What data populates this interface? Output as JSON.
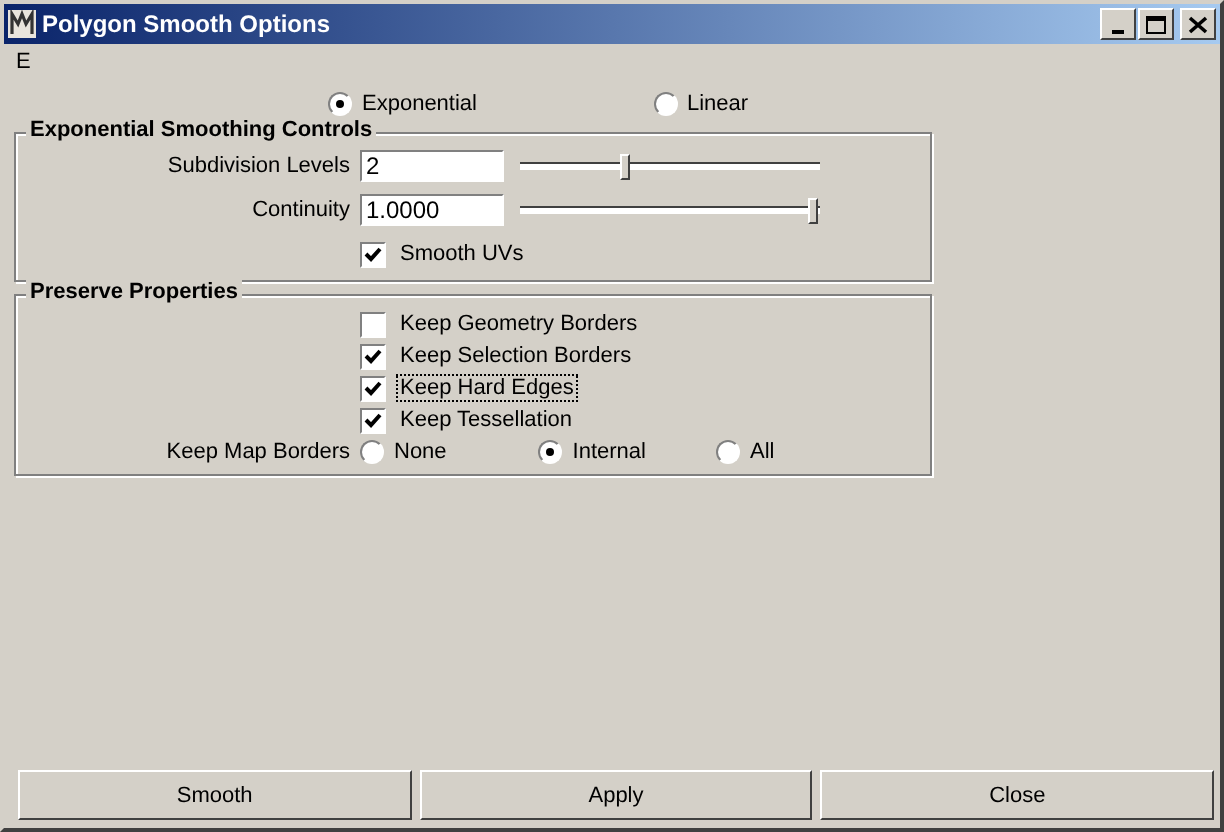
{
  "window": {
    "title": "Polygon Smooth Options"
  },
  "menu": [
    {
      "label": "E"
    }
  ],
  "method": {
    "options": [
      {
        "label": "Exponential",
        "selected": true
      },
      {
        "label": "Linear",
        "selected": false
      }
    ]
  },
  "smoothing": {
    "title": "Exponential Smoothing Controls",
    "fields": [
      {
        "label": "Subdivision Levels",
        "value": "2",
        "level": 0.35
      },
      {
        "label": "Continuity",
        "value": "1.0000",
        "level": 1.0
      }
    ],
    "checkbox": {
      "label": "Smooth UVs",
      "checked": true
    }
  },
  "preserve": {
    "title": "Preserve Properties",
    "checkboxes": [
      {
        "label": "Keep Geometry Borders",
        "checked": false,
        "focused": false
      },
      {
        "label": "Keep Selection Borders",
        "checked": true,
        "focused": false
      },
      {
        "label": "Keep Hard Edges",
        "checked": true,
        "focused": true
      },
      {
        "label": "Keep Tessellation",
        "checked": true,
        "focused": false
      }
    ],
    "map_borders": {
      "label": "Keep Map Borders",
      "options": [
        {
          "label": "None",
          "selected": false
        },
        {
          "label": "Internal",
          "selected": true
        },
        {
          "label": "All",
          "selected": false
        }
      ]
    }
  },
  "buttons": [
    {
      "label": "Smooth"
    },
    {
      "label": "Apply"
    },
    {
      "label": "Close"
    }
  ]
}
